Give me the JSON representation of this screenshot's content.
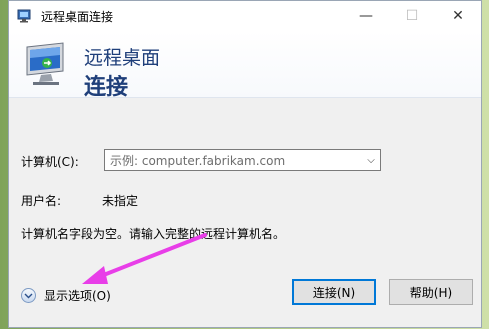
{
  "window": {
    "title": "远程桌面连接",
    "minimize_glyph": "—",
    "maximize_glyph": "☐",
    "close_glyph": "✕"
  },
  "banner": {
    "line1": "远程桌面",
    "line2": "连接"
  },
  "form": {
    "computer_label": "计算机(C):",
    "computer_placeholder": "示例: computer.fabrikam.com",
    "username_label": "用户名:",
    "username_value": "未指定",
    "message": "计算机名字段为空。请输入完整的远程计算机名。"
  },
  "options": {
    "label": "显示选项(O)"
  },
  "buttons": {
    "connect": "连接(N)",
    "help": "帮助(H)"
  },
  "colors": {
    "annotation_arrow": "#e83ee8",
    "banner_text": "#1f3f7a"
  },
  "icons": {
    "app": "remote-desktop-icon",
    "banner": "remote-desktop-monitor-icon",
    "combo": "chevron-down-icon",
    "options": "chevron-down-circle-icon"
  }
}
